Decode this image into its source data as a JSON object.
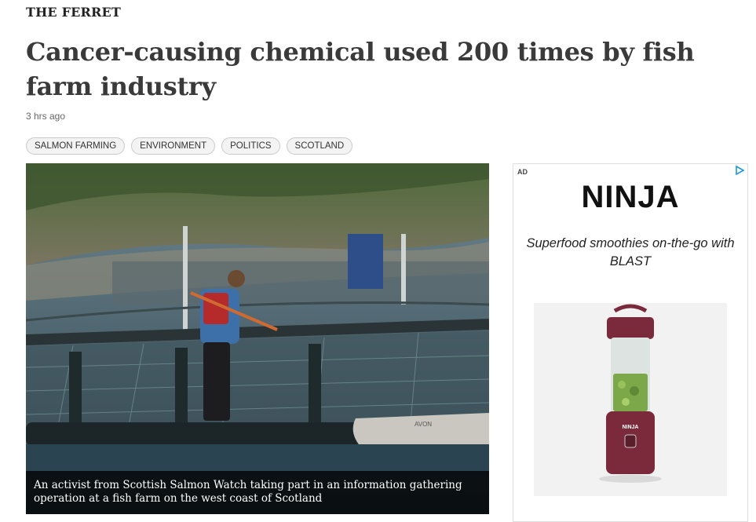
{
  "source": {
    "name": "THE FERRET"
  },
  "article": {
    "headline": "Cancer-causing chemical used 200 times by fish farm industry",
    "timestamp": "3 hrs ago",
    "tags": [
      "SALMON FARMING",
      "ENVIRONMENT",
      "POLITICS",
      "SCOTLAND"
    ],
    "image": {
      "caption": "An activist from Scottish Salmon Watch taking part in an information gathering operation at a fish farm on the west coast of Scotland",
      "boat_text": "AVON"
    }
  },
  "ad": {
    "label": "AD",
    "brand": "NINJA",
    "copy": "Superfood smoothies on-the-go with BLAST",
    "product_logo": "NINJA",
    "choices_icon": "ad-choices-icon",
    "accent_color": "#7a2a3a"
  },
  "colors": {
    "headline": "#3a3a3a",
    "caption_bg": "#000000",
    "tag_bg": "#f3f3f3"
  }
}
